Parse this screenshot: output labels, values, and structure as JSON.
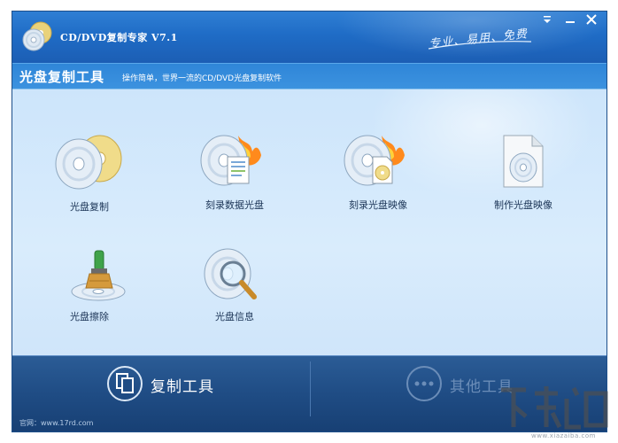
{
  "window": {
    "title": "CD/DVD复制专家 V7.1",
    "slogan": "专业、易用、免费"
  },
  "header": {
    "title": "光盘复制工具",
    "description": "操作简单，世界一流的CD/DVD光盘复制软件"
  },
  "tools": [
    {
      "label": "光盘复制",
      "icon": "disc-copy-icon"
    },
    {
      "label": "刻录数据光盘",
      "icon": "burn-data-disc-icon"
    },
    {
      "label": "刻录光盘映像",
      "icon": "burn-image-icon"
    },
    {
      "label": "制作光盘映像",
      "icon": "make-image-icon"
    },
    {
      "label": "光盘擦除",
      "icon": "disc-erase-icon"
    },
    {
      "label": "光盘信息",
      "icon": "disc-info-icon"
    }
  ],
  "bottom_tabs": [
    {
      "label": "复制工具",
      "active": true
    },
    {
      "label": "其他工具",
      "active": false
    }
  ],
  "footer": {
    "website": "官网：www.17rd.com"
  },
  "watermark": {
    "text": "www.xiazaiba.com"
  },
  "colors": {
    "title_bar": "#1f6cc6",
    "header_band": "#3c92df",
    "content_bg": "#d9ecfc",
    "bottom_bar": "#1f4c84",
    "label_text": "#1b3456"
  }
}
